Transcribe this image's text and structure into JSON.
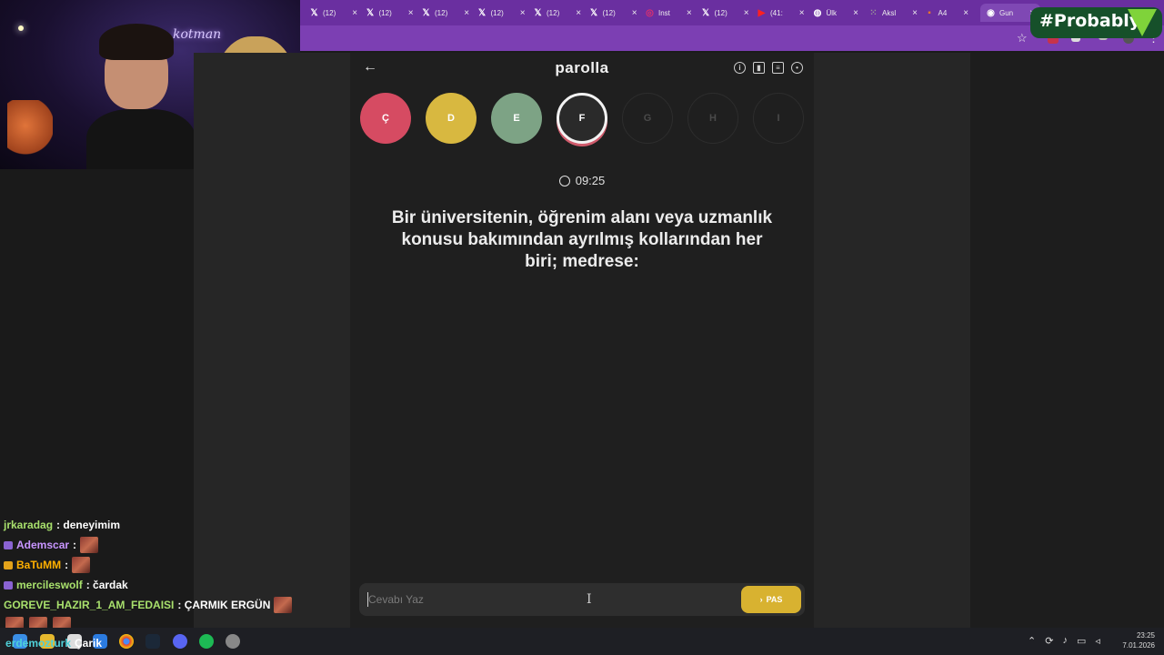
{
  "browser": {
    "tabs": [
      {
        "icon": "x-logo-icon",
        "label": "(12)"
      },
      {
        "icon": "x-logo-icon",
        "label": "(12)"
      },
      {
        "icon": "x-logo-icon",
        "label": "(12)"
      },
      {
        "icon": "x-logo-icon",
        "label": "(12)"
      },
      {
        "icon": "x-logo-icon",
        "label": "(12)"
      },
      {
        "icon": "x-logo-icon",
        "label": "(12)"
      },
      {
        "icon": "instagram-icon",
        "label": "Inst"
      },
      {
        "icon": "x-logo-icon",
        "label": "(12)"
      },
      {
        "icon": "youtube-icon",
        "label": "(41:"
      },
      {
        "icon": "globe-icon",
        "label": "Ülk"
      },
      {
        "icon": "grid-icon",
        "label": "Aksl"
      },
      {
        "icon": "site-icon",
        "label": "A4"
      },
      {
        "icon": "chrome-icon",
        "label": "Gun"
      }
    ],
    "overlay_brand": "#Probably"
  },
  "webcam": {
    "neon_sign": "kotman"
  },
  "game": {
    "title": "parolla",
    "back_symbol": "←",
    "header_icons": [
      "info-icon",
      "stats-icon",
      "chat-icon",
      "profile-icon"
    ],
    "letters": [
      {
        "char": "Ç",
        "state": "wrong"
      },
      {
        "char": "D",
        "state": "pass"
      },
      {
        "char": "E",
        "state": "correct"
      },
      {
        "char": "F",
        "state": "current"
      },
      {
        "char": "G",
        "state": "pending"
      },
      {
        "char": "H",
        "state": "pending"
      },
      {
        "char": "I",
        "state": "pending"
      }
    ],
    "timer": "09:25",
    "question": "Bir üniversitenin, öğrenim alanı veya uzmanlık konusu bakımından ayrılmış kollarından her biri; medrese:",
    "answer_placeholder": "Cevabı Yaz",
    "pass_label": "PAS",
    "pass_icon": "›"
  },
  "chat": [
    {
      "user": "jrkaradag",
      "text": ": deneyimim",
      "color": "#a8e06c",
      "badge": "",
      "emote": false
    },
    {
      "user": "Ademscar",
      "text": ":",
      "color": "#c895ff",
      "badge": "#8a63d2",
      "emote": true
    },
    {
      "user": "BaTuMM",
      "text": ":",
      "color": "#ffb000",
      "badge": "#e3a21a",
      "emote": true
    },
    {
      "user": "mercileswolf",
      "text": ": čardak",
      "color": "#a8e06c",
      "badge": "#8a63d2",
      "emote": false
    },
    {
      "user": "GOREVE_HAZIR_1_AM_FEDAISI",
      "text": ": ÇARMIK ERGÜN",
      "color": "#a8e06c",
      "badge": "",
      "emote": true
    }
  ],
  "overlay_text": {
    "name": "erdemozturk",
    "cut": "Çarik"
  },
  "system": {
    "time": "23:25",
    "date": "7.01.2026"
  },
  "colors": {
    "wrong": "#d64b62",
    "pass": "#d8b840",
    "correct": "#7da385",
    "accent": "#6a2fa0"
  }
}
